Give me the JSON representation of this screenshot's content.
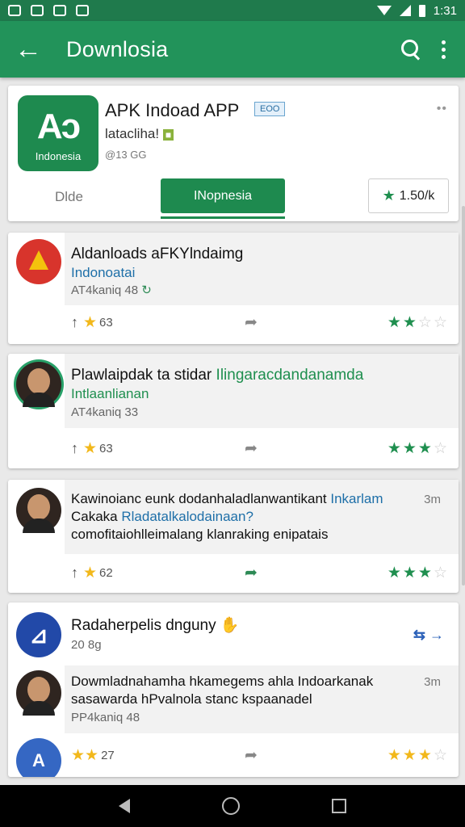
{
  "status": {
    "time": "1:31"
  },
  "appbar": {
    "title": "Downlosia",
    "back_icon": "arrow-left-icon",
    "search_icon": "search-icon",
    "more_icon": "more-vert-icon"
  },
  "app": {
    "name": "APK Indoad APP",
    "badge": "EOO",
    "subtitle": "latacliha!",
    "meta": "@13 GG",
    "logo_mark": "Aɔ",
    "logo_text": "Indonesia",
    "dots": "••",
    "tab_idle": "Dlde",
    "tab_active": "INopnesia",
    "rating": "1.50/k"
  },
  "feed": [
    {
      "title": "Aldanloads aFKYlndaimg",
      "sub": "Indonoatai",
      "meta": "AT4kaniq 48",
      "count": "63",
      "stars": 2
    },
    {
      "title_a": "Plawlaipdak ta stidar ",
      "title_b": "Ilingaracdandanamda",
      "sub": "Intlaanlianan",
      "meta": "AT4kaniq 33",
      "count": "63",
      "stars": 3
    },
    {
      "title_a": "Kawinoianc eunk dodanhaladlanwantikant ",
      "title_b": "Inkarlam",
      "time": "3m",
      "line2_a": "Cakaka ",
      "line2_b": "Rladatalkalodainaan?",
      "line3": "comofitaiohlleimalang klanraking enipatais",
      "count": "62",
      "stars": 3
    },
    {
      "title": "Radaherpelis dnguny",
      "meta": "20 8g",
      "arrow": "⇆ →",
      "reply_title": "Dowmladnahamha hkamegems ahla Indoarkanak",
      "reply_time": "3m",
      "reply_line2": "sasawarda hPvalnola stanc kspaanadel",
      "reply_meta": "PP4kaniq 48",
      "count": "27",
      "stars": 3
    }
  ]
}
